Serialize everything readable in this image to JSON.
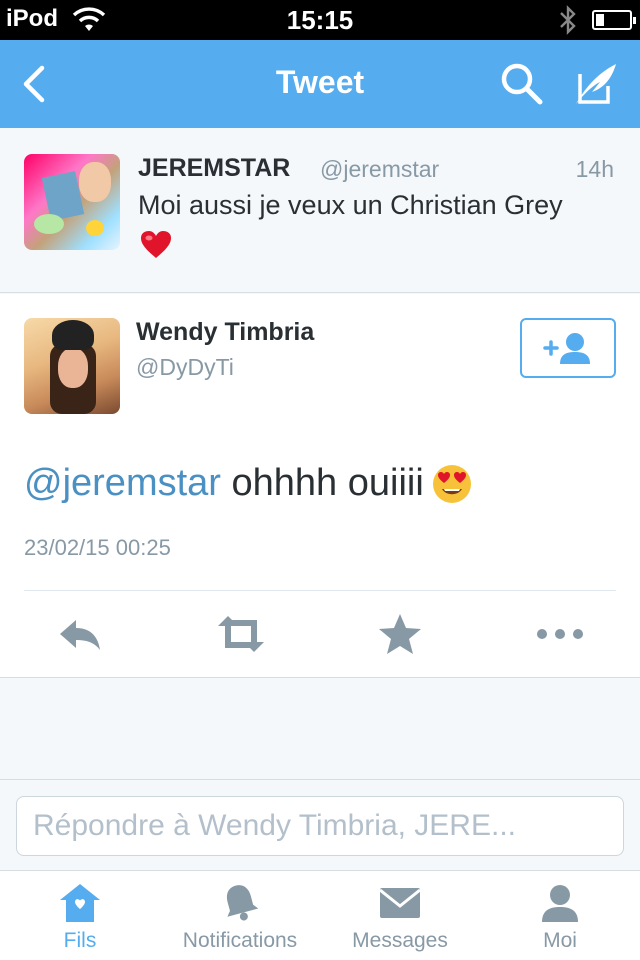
{
  "status_bar": {
    "carrier": "iPod",
    "time": "15:15",
    "battery_level": 0.25
  },
  "nav": {
    "title": "Tweet",
    "back_icon": "chevron-left-icon",
    "search_icon": "search-icon",
    "compose_icon": "compose-feather-icon"
  },
  "parent_tweet": {
    "name": "JEREMSTAR",
    "handle": "@jeremstar",
    "time": "14h",
    "text": "Moi aussi je veux un Christian Grey",
    "emoji": "red-heart"
  },
  "tweet": {
    "name": "Wendy Timbria",
    "handle": "@DyDyTi",
    "mention": "@jeremstar",
    "text": " ohhhh ouiiii",
    "emoji": "heart-eyes-smiley",
    "date": "23/02/15 00:25",
    "follow_icon": "add-user-icon"
  },
  "actions": [
    {
      "name": "reply",
      "icon": "reply-icon"
    },
    {
      "name": "retweet",
      "icon": "retweet-icon"
    },
    {
      "name": "favorite",
      "icon": "star-icon"
    },
    {
      "name": "more",
      "icon": "more-dots-icon"
    }
  ],
  "reply": {
    "placeholder": "Répondre à Wendy Timbria, JERE..."
  },
  "tabs": [
    {
      "label": "Fils",
      "icon": "home-icon",
      "active": true
    },
    {
      "label": "Notifications",
      "icon": "bell-icon",
      "active": false
    },
    {
      "label": "Messages",
      "icon": "envelope-icon",
      "active": false
    },
    {
      "label": "Moi",
      "icon": "user-icon",
      "active": false
    }
  ],
  "colors": {
    "brand": "#55acee",
    "text": "#292f33",
    "secondary": "#8899a6",
    "icon_gray": "#8899a6",
    "mention": "#4a90c2"
  }
}
